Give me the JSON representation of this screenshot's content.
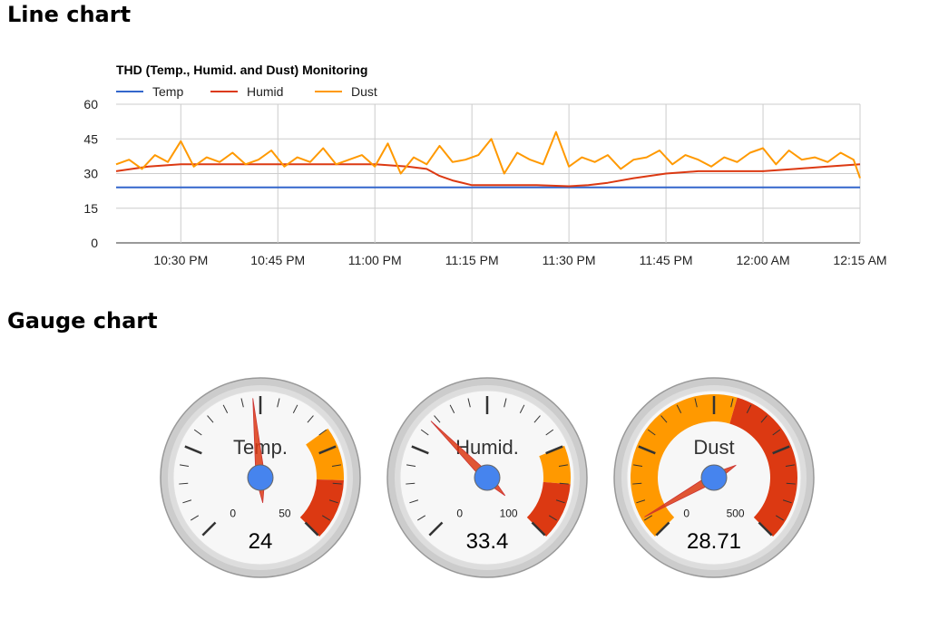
{
  "sections": {
    "line_heading": "Line chart",
    "gauge_heading": "Gauge chart"
  },
  "chart_data": [
    {
      "type": "line",
      "title": "THD (Temp., Humid. and Dust) Monitoring",
      "xlabel": "",
      "ylabel": "",
      "ylim": [
        0,
        60
      ],
      "yticks": [
        0,
        15,
        30,
        45,
        60
      ],
      "xlim": [
        "10:20 PM",
        "12:15 AM"
      ],
      "xticks": [
        "10:30 PM",
        "10:45 PM",
        "11:00 PM",
        "11:15 PM",
        "11:30 PM",
        "11:45 PM",
        "12:00 AM",
        "12:15 AM"
      ],
      "grid": true,
      "legend_position": "top-left",
      "series": [
        {
          "name": "Temp",
          "color": "#3366cc",
          "x": [
            "10:20 PM",
            "10:35 PM",
            "10:50 PM",
            "11:05 PM",
            "11:20 PM",
            "11:35 PM",
            "11:50 PM",
            "12:05 AM",
            "12:15 AM"
          ],
          "y": [
            24,
            24,
            24,
            24,
            24,
            24,
            24,
            24,
            24
          ]
        },
        {
          "name": "Humid",
          "color": "#dc3912",
          "x": [
            "10:20 PM",
            "10:25 PM",
            "10:30 PM",
            "10:35 PM",
            "10:40 PM",
            "10:45 PM",
            "10:50 PM",
            "10:55 PM",
            "11:00 PM",
            "11:05 PM",
            "11:08 PM",
            "11:10 PM",
            "11:12 PM",
            "11:15 PM",
            "11:20 PM",
            "11:25 PM",
            "11:30 PM",
            "11:33 PM",
            "11:36 PM",
            "11:40 PM",
            "11:45 PM",
            "11:50 PM",
            "11:55 PM",
            "12:00 AM",
            "12:05 AM",
            "12:10 AM",
            "12:15 AM"
          ],
          "y": [
            31,
            33,
            34,
            34,
            34,
            34,
            34,
            34,
            34,
            33,
            32,
            29,
            27,
            25,
            25,
            25,
            24.5,
            25,
            26,
            28,
            30,
            31,
            31,
            31,
            32,
            33,
            34
          ]
        },
        {
          "name": "Dust",
          "color": "#ff9900",
          "x": [
            "10:20 PM",
            "10:22 PM",
            "10:24 PM",
            "10:26 PM",
            "10:28 PM",
            "10:30 PM",
            "10:32 PM",
            "10:34 PM",
            "10:36 PM",
            "10:38 PM",
            "10:40 PM",
            "10:42 PM",
            "10:44 PM",
            "10:46 PM",
            "10:48 PM",
            "10:50 PM",
            "10:52 PM",
            "10:54 PM",
            "10:56 PM",
            "10:58 PM",
            "11:00 PM",
            "11:02 PM",
            "11:04 PM",
            "11:06 PM",
            "11:08 PM",
            "11:10 PM",
            "11:12 PM",
            "11:14 PM",
            "11:16 PM",
            "11:18 PM",
            "11:20 PM",
            "11:22 PM",
            "11:24 PM",
            "11:26 PM",
            "11:28 PM",
            "11:30 PM",
            "11:32 PM",
            "11:34 PM",
            "11:36 PM",
            "11:38 PM",
            "11:40 PM",
            "11:42 PM",
            "11:44 PM",
            "11:46 PM",
            "11:48 PM",
            "11:50 PM",
            "11:52 PM",
            "11:54 PM",
            "11:56 PM",
            "11:58 PM",
            "12:00 AM",
            "12:02 AM",
            "12:04 AM",
            "12:06 AM",
            "12:08 AM",
            "12:10 AM",
            "12:12 AM",
            "12:14 AM",
            "12:15 AM"
          ],
          "y": [
            34,
            36,
            32,
            38,
            35,
            44,
            33,
            37,
            35,
            39,
            34,
            36,
            40,
            33,
            37,
            35,
            41,
            34,
            36,
            38,
            33,
            43,
            30,
            37,
            34,
            42,
            35,
            36,
            38,
            45,
            30,
            39,
            36,
            34,
            48,
            33,
            37,
            35,
            38,
            32,
            36,
            37,
            40,
            34,
            38,
            36,
            33,
            37,
            35,
            39,
            41,
            34,
            40,
            36,
            37,
            35,
            39,
            36,
            28
          ]
        }
      ]
    },
    {
      "type": "gauge",
      "label": "Temp.",
      "value": 24,
      "value_text": "24",
      "min": 0,
      "max": 50,
      "min_text": "0",
      "max_text": "50",
      "bands": [
        {
          "from": 35,
          "to": 42,
          "color": "#ff9900"
        },
        {
          "from": 42,
          "to": 50,
          "color": "#dc3912"
        }
      ]
    },
    {
      "type": "gauge",
      "label": "Humid.",
      "value": 33.4,
      "value_text": "33.4",
      "min": 0,
      "max": 100,
      "min_text": "0",
      "max_text": "100",
      "bands": [
        {
          "from": 75,
          "to": 85,
          "color": "#ff9900"
        },
        {
          "from": 85,
          "to": 100,
          "color": "#dc3912"
        }
      ]
    },
    {
      "type": "gauge",
      "label": "Dust",
      "value": 28.71,
      "value_text": "28.71",
      "min": 0,
      "max": 500,
      "min_text": "0",
      "max_text": "500",
      "bands": [
        {
          "from": 0,
          "to": 280,
          "color": "#ff9900"
        },
        {
          "from": 280,
          "to": 500,
          "color": "#dc3912"
        }
      ]
    }
  ]
}
